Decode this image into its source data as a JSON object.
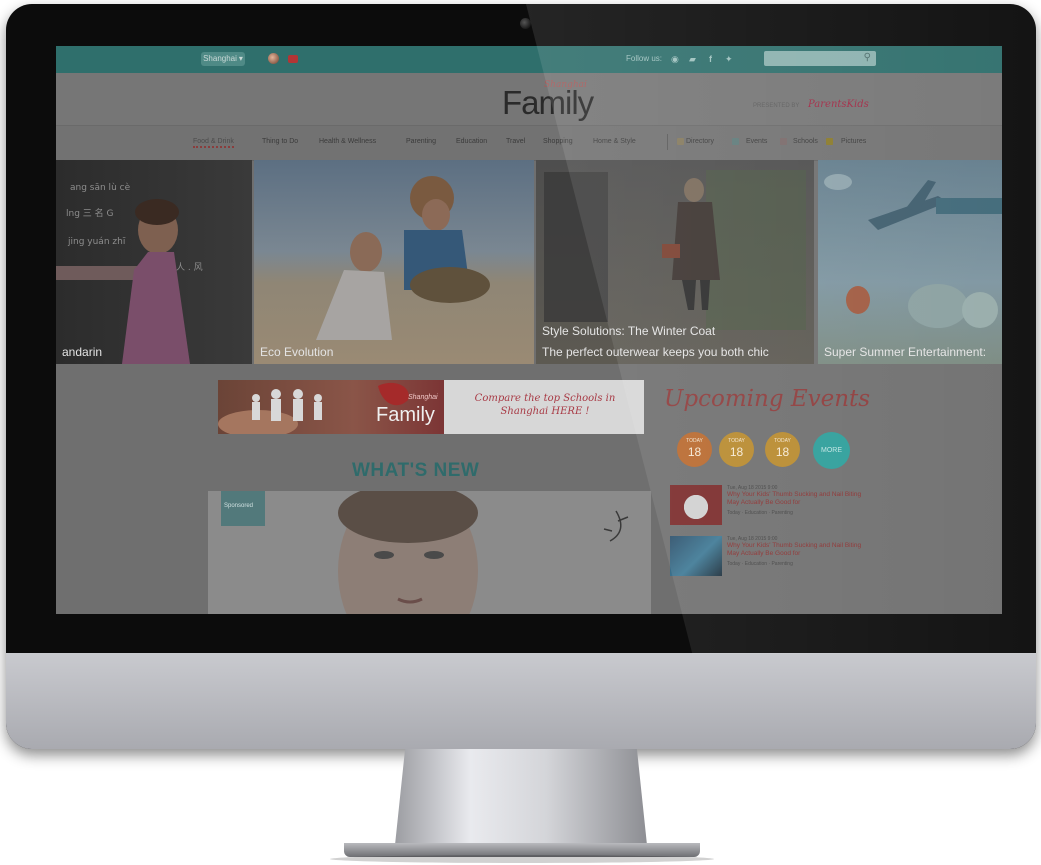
{
  "topbar": {
    "language": "Shanghai",
    "follow_label": "Follow us:",
    "social_icons": [
      "rss-icon",
      "youtube-icon",
      "facebook-icon",
      "twitter-icon"
    ]
  },
  "header": {
    "logo_city": "Shanghai",
    "logo_title": "Family",
    "presented_by": "PRESENTED BY",
    "partner": "ParentsKids"
  },
  "nav": {
    "items": [
      "Food & Drink",
      "Thing to Do",
      "Health & Wellness",
      "Parenting",
      "Education",
      "Travel",
      "Shopping",
      "Home & Style"
    ],
    "extras": [
      "Directory",
      "Events",
      "Schools",
      "Pictures"
    ]
  },
  "slides": [
    {
      "caption": "andarin"
    },
    {
      "caption": "Eco Evolution"
    },
    {
      "title": "Style Solutions: The Winter Coat",
      "caption": "The perfect outerwear keeps you both chic"
    },
    {
      "caption": "Super Summer Entertainment:"
    }
  ],
  "banner": {
    "city": "Shanghai",
    "brand": "Family",
    "cta": "Compare the top Schools in Shanghai HERE !"
  },
  "whats_new": {
    "title": "WHAT'S NEW",
    "sponsored": "Sponsored"
  },
  "events": {
    "title": "Upcoming Events",
    "days": [
      {
        "label": "TODAY",
        "day": "18",
        "color": "#b8692e"
      },
      {
        "label": "TODAY",
        "day": "18",
        "color": "#b88a2e"
      },
      {
        "label": "TODAY",
        "day": "18",
        "color": "#b88a2e"
      }
    ],
    "more": "MORE",
    "news": [
      {
        "date": "Tue, Aug 18 2015 9:00",
        "title": "Why Your Kids' Thumb Sucking and Nail Biting May Actually Be Good for",
        "tags": "Today · Education · Parenting"
      },
      {
        "date": "Tue, Aug 18 2015 9:00",
        "title": "Why Your Kids' Thumb Sucking and Nail Biting May Actually Be Good for",
        "tags": "Today · Education · Parenting"
      }
    ]
  },
  "colors": {
    "topbar": "#2f6f6c",
    "accent_teal": "#2f6b6b",
    "accent_red": "#8e3b3b"
  }
}
